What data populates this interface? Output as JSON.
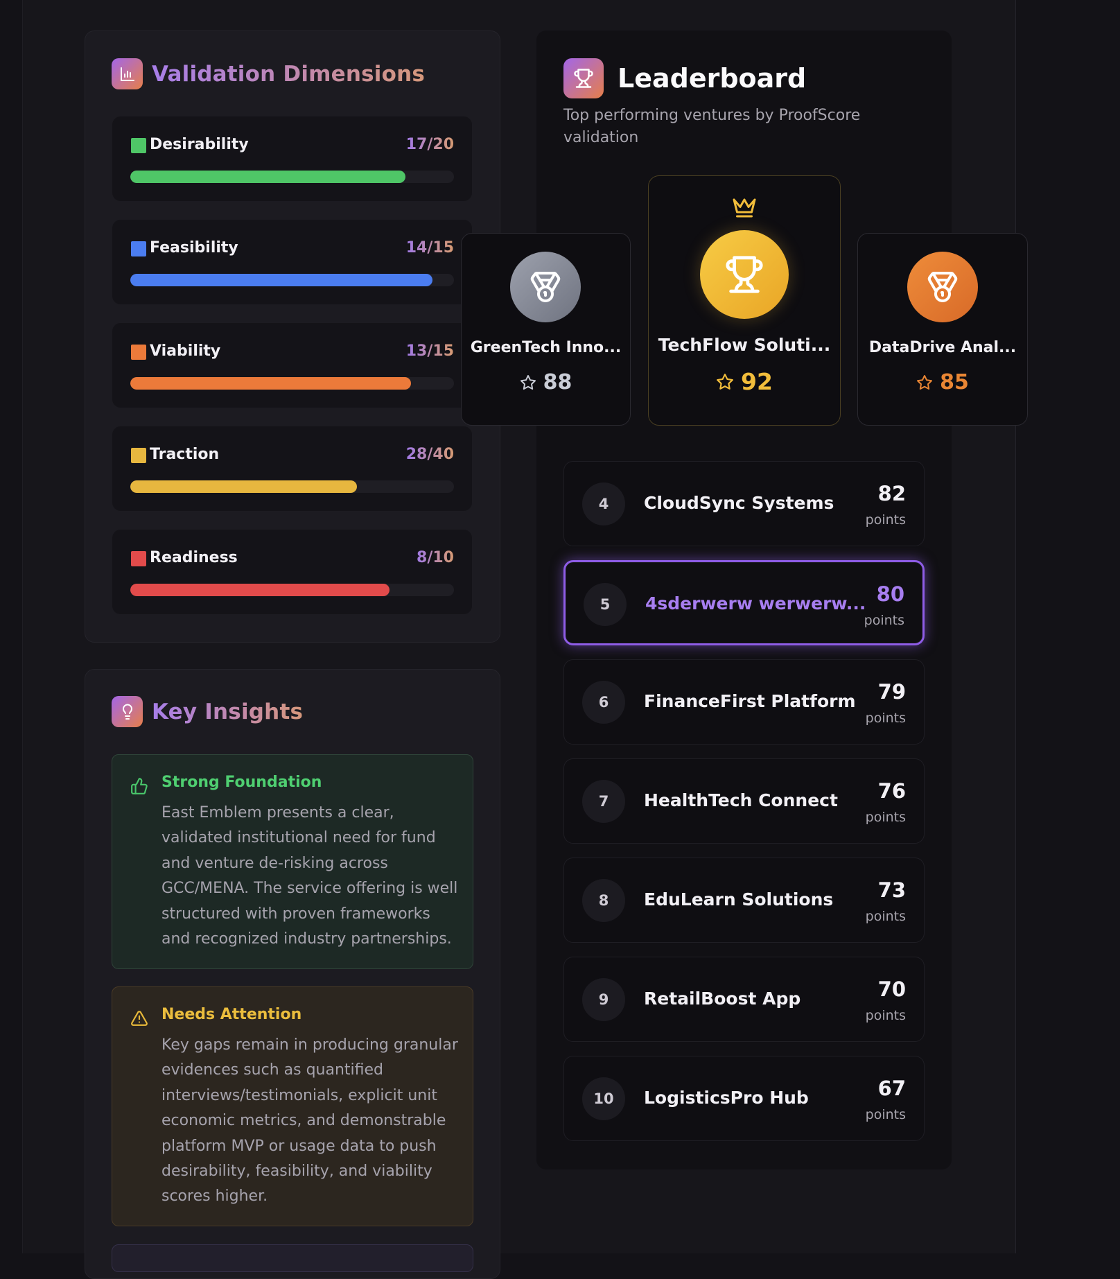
{
  "validation": {
    "title": "Validation Dimensions",
    "icon": "bar-chart-icon",
    "dimensions": [
      {
        "label": "Desirability",
        "score": "17/20",
        "fraction": 0.85,
        "color": "#4fc667"
      },
      {
        "label": "Feasibility",
        "score": "14/15",
        "fraction": 0.933,
        "color": "#4b7df0"
      },
      {
        "label": "Viability",
        "score": "13/15",
        "fraction": 0.867,
        "color": "#ec7a3a"
      },
      {
        "label": "Traction",
        "score": "28/40",
        "fraction": 0.7,
        "color": "#e7b73f"
      },
      {
        "label": "Readiness",
        "score": "8/10",
        "fraction": 0.8,
        "color": "#e24b4b"
      }
    ]
  },
  "insights": {
    "title": "Key Insights",
    "icon": "lightbulb-icon",
    "strong": {
      "title": "Strong Foundation",
      "icon": "thumbs-up-icon",
      "text": "East Emblem presents a clear, validated institutional need for fund and venture de-risking across GCC/MENA. The service offering is well structured with proven frameworks and recognized industry partnerships."
    },
    "attention": {
      "title": "Needs Attention",
      "icon": "warning-icon",
      "text": "Key gaps remain in producing granular evidences such as quantified interviews/testimonials, explicit unit economic metrics, and demonstrable platform MVP or usage data to push desirability, feasibility, and viability scores higher."
    }
  },
  "leaderboard": {
    "title": "Leaderboard",
    "icon": "trophy-icon",
    "subtitle": "Top performing ventures by ProofScore validation",
    "podium": [
      {
        "rank": 2,
        "name": "GreenTech Inno...",
        "score": "88",
        "icon": "medal-icon",
        "color": "#c9ccd6"
      },
      {
        "rank": 1,
        "name": "TechFlow Soluti...",
        "score": "92",
        "icon": "trophy-icon",
        "crown": "crown-icon",
        "color": "#f2bd3b"
      },
      {
        "rank": 3,
        "name": "DataDrive Anal...",
        "score": "85",
        "icon": "medal-icon",
        "color": "#e98634"
      }
    ],
    "unit": "points",
    "rows": [
      {
        "rank": "4",
        "name": "CloudSync Systems",
        "score": "82",
        "active": false
      },
      {
        "rank": "5",
        "name": "4sderwerw werwerw...",
        "score": "80",
        "active": true
      },
      {
        "rank": "6",
        "name": "FinanceFirst Platform",
        "score": "79",
        "active": false
      },
      {
        "rank": "7",
        "name": "HealthTech Connect",
        "score": "76",
        "active": false
      },
      {
        "rank": "8",
        "name": "EduLearn Solutions",
        "score": "73",
        "active": false
      },
      {
        "rank": "9",
        "name": "RetailBoost App",
        "score": "70",
        "active": false
      },
      {
        "rank": "10",
        "name": "LogisticsPro Hub",
        "score": "67",
        "active": false
      }
    ]
  }
}
